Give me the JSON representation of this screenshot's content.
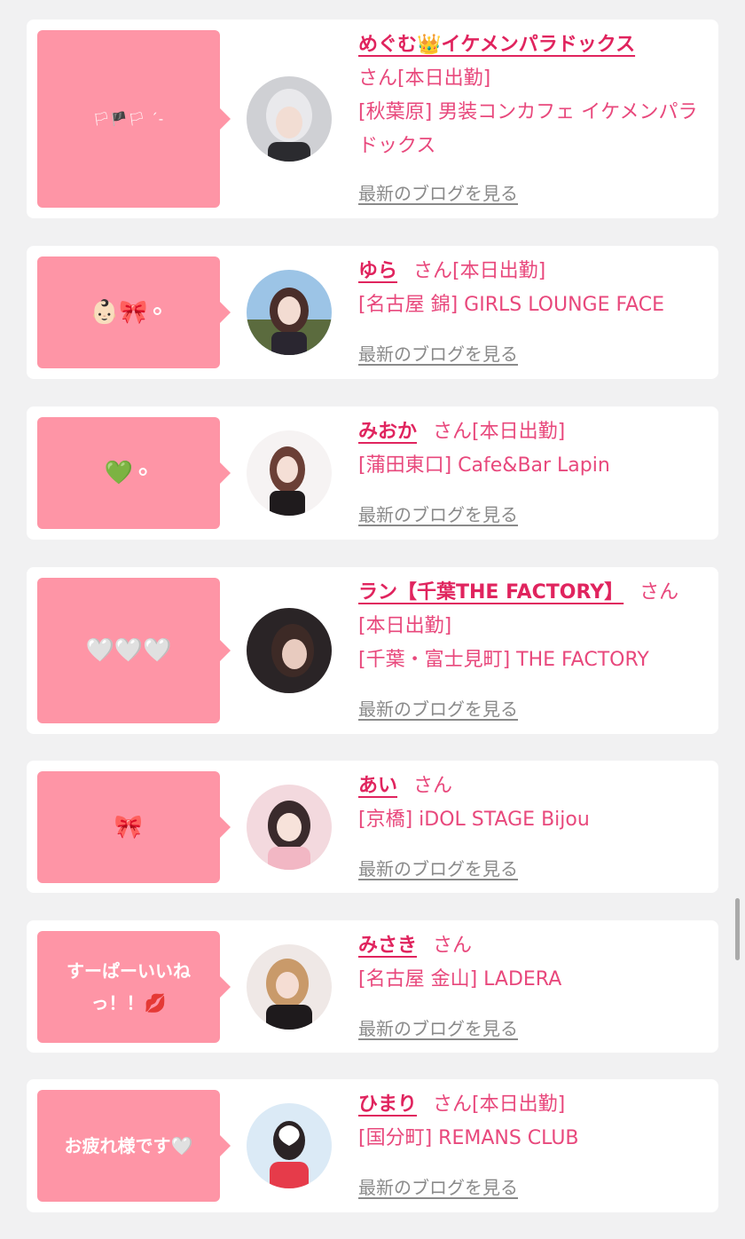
{
  "entries": [
    {
      "message": "🏳🏴🏳 ˊ-",
      "name": "めぐむ👑イケメンパラドックス",
      "san": "さん",
      "status": "[本日出勤]",
      "shop": "[秋葉原] 男装コンカフェ イケメンパラドックス",
      "blog": "最新のブログを見る"
    },
    {
      "message": "👶🏻🎀⚬",
      "name": "ゆら",
      "san": "さん",
      "status": "[本日出勤]",
      "shop": "[名古屋 錦] GIRLS LOUNGE FACE",
      "blog": "最新のブログを見る"
    },
    {
      "message": "💚⚬",
      "name": "みおか",
      "san": "さん",
      "status": "[本日出勤]",
      "shop": "[蒲田東口] Cafe&Bar Lapin",
      "blog": "最新のブログを見る"
    },
    {
      "message": "🤍🤍🤍",
      "name": "ラン【千葉THE FACTORY】",
      "san": "さん",
      "status": "[本日出勤]",
      "shop": "[千葉・富士見町] THE FACTORY",
      "blog": "最新のブログを見る"
    },
    {
      "message": "🎀",
      "name": "あい",
      "san": "さん",
      "status": "",
      "shop": "[京橋] iDOL STAGE Bijou",
      "blog": "最新のブログを見る"
    },
    {
      "message": "すーぱーいいねっ！！💋",
      "name": "みさき",
      "san": "さん",
      "status": "",
      "shop": "[名古屋 金山] LADERA",
      "blog": "最新のブログを見る"
    },
    {
      "message": "お疲れ様です🤍",
      "name": "ひまり",
      "san": "さん",
      "status": "[本日出勤]",
      "shop": "[国分町] REMANS CLUB",
      "blog": "最新のブログを見る"
    }
  ],
  "colors": {
    "background": "#f1f1f2",
    "card": "#ffffff",
    "bubble": "#fe95a6",
    "name": "#e0245e",
    "text": "#e8487c",
    "link": "#8a8a8a"
  }
}
